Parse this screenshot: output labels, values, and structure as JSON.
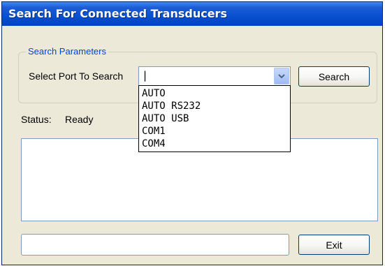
{
  "window": {
    "title": "Search For Connected Transducers"
  },
  "search_parameters": {
    "legend": "Search Parameters",
    "port_label": "Select Port To Search",
    "selected_value": "|",
    "search_button": "Search",
    "port_options": [
      "AUTO",
      "AUTO RS232",
      "AUTO USB",
      "COM1",
      "COM4"
    ]
  },
  "status": {
    "label": "Status:",
    "value": "Ready"
  },
  "footer": {
    "exit_button": "Exit"
  },
  "icons": {
    "combo_arrow": "chevron-down-icon"
  }
}
